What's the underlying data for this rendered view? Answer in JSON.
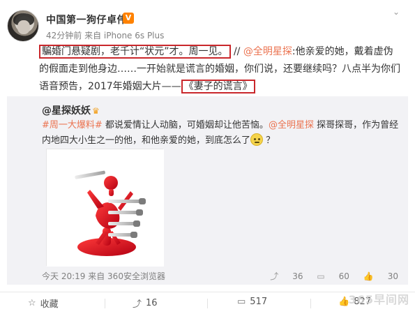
{
  "post": {
    "user_name": "中国第一狗仔卓伟",
    "vip_badge": "V",
    "meta_time": "42分钟前",
    "meta_source": "来自 iPhone 6s Plus",
    "highlight_1": "騙婚门悬疑剧，老千计“状元”才。周一见。",
    "text_sep": "//",
    "mention": "@全明星探",
    "text_1": ":他亲爱的她，戴着虚伪的假面走到他身边……一开始就是谎言的婚姻，你们说，还要继续吗？八点半为你们语音预告，2017年婚姻大片——",
    "highlight_2": "《妻子的谎言》"
  },
  "repost": {
    "author": "@星探妖妖",
    "author_crown": "♛",
    "tag": "#周一大爆料#",
    "text_a": " 都说爱情让人动脑，可婚姻却让他苦恼。",
    "mention": "@全明星探",
    "text_b": " 探哥探哥，作为曾经内地四大小生之一的他，和他亲爱的她，到底怎么了",
    "text_c": " ？",
    "time": "今天 20:19",
    "source": "来自 360安全浏览器",
    "stats": {
      "repost_count": "36",
      "comment_count": "60",
      "like_count": "30"
    }
  },
  "actions": {
    "favorite": "收藏",
    "repost": "16",
    "comment": "517",
    "like": "827"
  },
  "watermark": "365早间网",
  "colors": {
    "accent": "#eb7350",
    "box": "#c9272b",
    "vip": "#ff8200",
    "panel": "#f2f2f5"
  },
  "icons": {
    "favorite": "star-icon",
    "repost": "repost-icon",
    "comment": "comment-icon",
    "like": "thumb-up-icon",
    "chevron": "chevron-down-icon"
  }
}
